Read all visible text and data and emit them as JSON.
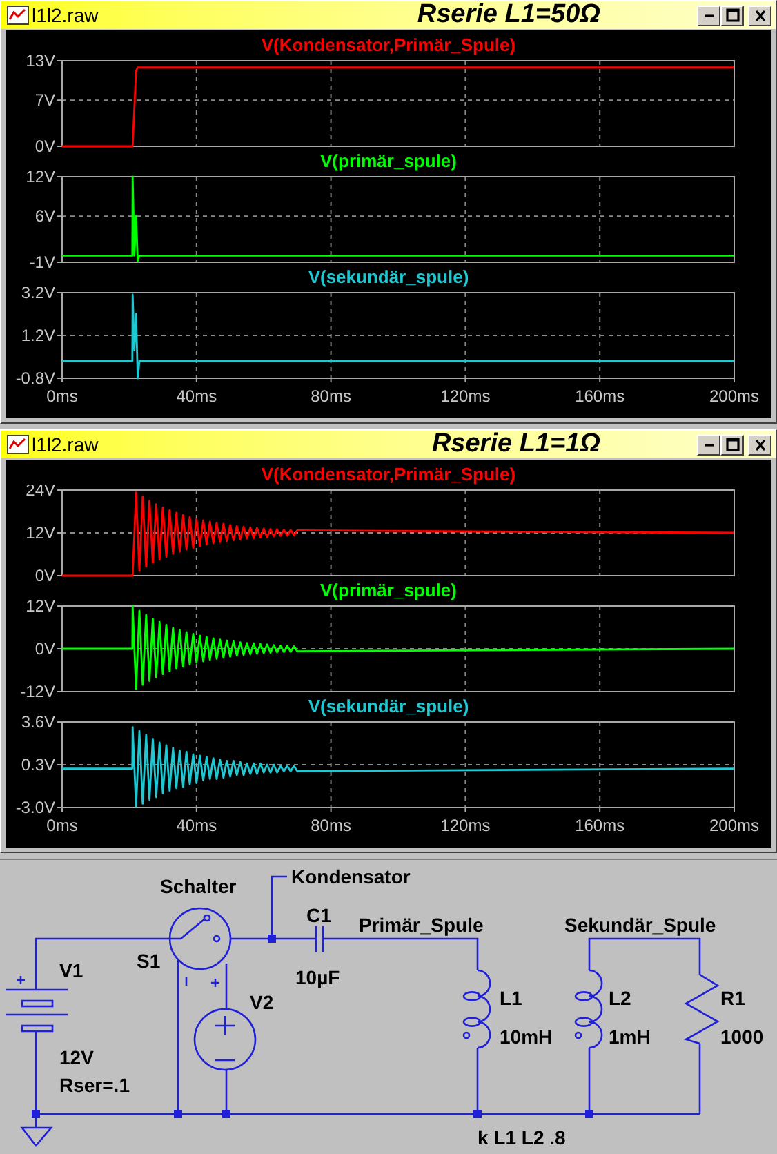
{
  "windows": [
    {
      "file": "l1l2.raw",
      "title": "Rserie L1=50Ω",
      "panes": [
        {
          "chart_data": {
            "type": "line",
            "grid": true,
            "x": [
              0,
              20.9,
              21,
              21.5,
              22,
              22.5,
              23,
              200
            ],
            "series": [
              {
                "name": "V(Kondensator,Primär_Spule)",
                "color": "#ff0000",
                "values": [
                  0,
                  0,
                  0,
                  6,
                  11.5,
                  12,
                  12,
                  12
                ]
              }
            ],
            "xlim": [
              0,
              200
            ],
            "ylim": [
              0,
              13
            ],
            "yticks": [
              {
                "value": 0,
                "label": "0V"
              },
              {
                "value": 7,
                "label": "7V"
              },
              {
                "value": 13,
                "label": "13V"
              }
            ]
          }
        },
        {
          "chart_data": {
            "type": "line",
            "grid": true,
            "x": [
              0,
              20.9,
              21,
              21.5,
              22,
              22.5,
              23,
              200
            ],
            "series": [
              {
                "name": "V(primär_spule)",
                "color": "#00ff00",
                "values": [
                  0,
                  0,
                  12,
                  0,
                  6,
                  -0.8,
                  0,
                  0
                ]
              }
            ],
            "xlim": [
              0,
              200
            ],
            "ylim": [
              -1,
              12
            ],
            "yticks": [
              {
                "value": -1,
                "label": "-1V"
              },
              {
                "value": 6,
                "label": "6V"
              },
              {
                "value": 12,
                "label": "12V"
              }
            ]
          }
        },
        {
          "chart_data": {
            "type": "line",
            "grid": true,
            "x": [
              0,
              20.9,
              21,
              21.5,
              22,
              22.5,
              23,
              200
            ],
            "series": [
              {
                "name": "V(sekundär_spule)",
                "color": "#1ec8d2",
                "values": [
                  0,
                  0,
                  3.1,
                  0.5,
                  2.2,
                  -0.8,
                  0,
                  0
                ]
              }
            ],
            "xlim": [
              0,
              200
            ],
            "ylim": [
              -0.8,
              3.2
            ],
            "yticks": [
              {
                "value": -0.8,
                "label": "-0.8V"
              },
              {
                "value": 1.2,
                "label": "1.2V"
              },
              {
                "value": 3.2,
                "label": "3.2V"
              }
            ],
            "xticks": [
              {
                "value": 0,
                "label": "0ms"
              },
              {
                "value": 40,
                "label": "40ms"
              },
              {
                "value": 80,
                "label": "80ms"
              },
              {
                "value": 120,
                "label": "120ms"
              },
              {
                "value": 160,
                "label": "160ms"
              },
              {
                "value": 200,
                "label": "200ms"
              }
            ]
          }
        }
      ]
    },
    {
      "file": "l1l2.raw",
      "title": "Rserie L1=1Ω",
      "panes": [
        {
          "chart_data": {
            "type": "line",
            "grid": true,
            "x": [
              0,
              20.9,
              21,
              22,
              23,
              24,
              25,
              26,
              27,
              28,
              29,
              30,
              31,
              32,
              33,
              34,
              35,
              36,
              37,
              38,
              39,
              40,
              41,
              42,
              43,
              44,
              45,
              46,
              47,
              48,
              49,
              50,
              51,
              52,
              53,
              54,
              55,
              56,
              57,
              58,
              59,
              60,
              61,
              62,
              63,
              64,
              65,
              66,
              67,
              68,
              69,
              70,
              200
            ],
            "series": [
              {
                "name": "V(Kondensator,Primär_Spule)",
                "color": "#ff0000",
                "values": [
                  0,
                  0,
                  0,
                  23.3,
                  1.3,
                  22.1,
                  2.5,
                  21,
                  3.6,
                  20,
                  4.5,
                  19.1,
                  5.3,
                  18.3,
                  6.1,
                  17.6,
                  6.7,
                  17,
                  7.3,
                  16.4,
                  7.8,
                  15.9,
                  8.3,
                  15.5,
                  8.7,
                  15.1,
                  9.1,
                  14.8,
                  9.4,
                  14.5,
                  9.7,
                  14.2,
                  9.9,
                  13.9,
                  10.2,
                  13.7,
                  10.4,
                  13.5,
                  10.5,
                  13.4,
                  10.7,
                  13.2,
                  10.8,
                  13.1,
                  11,
                  13,
                  11.1,
                  12.9,
                  11.2,
                  12.8,
                  11.3,
                  12.7,
                  12
                ]
              }
            ],
            "xlim": [
              0,
              200
            ],
            "ylim": [
              0,
              24
            ],
            "yticks": [
              {
                "value": 0,
                "label": "0V"
              },
              {
                "value": 12,
                "label": "12V"
              },
              {
                "value": 24,
                "label": "24V"
              }
            ]
          }
        },
        {
          "chart_data": {
            "type": "line",
            "grid": true,
            "x": [
              0,
              20.9,
              21,
              22,
              23,
              24,
              25,
              26,
              27,
              28,
              29,
              30,
              31,
              32,
              33,
              34,
              35,
              36,
              37,
              38,
              39,
              40,
              41,
              42,
              43,
              44,
              45,
              46,
              47,
              48,
              49,
              50,
              51,
              52,
              53,
              54,
              55,
              56,
              57,
              58,
              59,
              60,
              61,
              62,
              63,
              64,
              65,
              66,
              67,
              68,
              69,
              70,
              200
            ],
            "series": [
              {
                "name": "V(primär_spule)",
                "color": "#00ff00",
                "values": [
                  0,
                  0,
                  12,
                  -11.3,
                  10.7,
                  -10.1,
                  9.5,
                  -9,
                  8.4,
                  -8,
                  7.5,
                  -7.1,
                  6.7,
                  -6.3,
                  5.9,
                  -5.6,
                  5.3,
                  -5,
                  4.7,
                  -4.4,
                  4.2,
                  -3.9,
                  3.7,
                  -3.5,
                  3.3,
                  -3.1,
                  2.9,
                  -2.8,
                  2.6,
                  -2.5,
                  2.3,
                  -2.2,
                  2.1,
                  -1.9,
                  1.8,
                  -1.7,
                  1.6,
                  -1.5,
                  1.5,
                  -1.4,
                  1.3,
                  -1.2,
                  1.2,
                  -1.1,
                  1,
                  -1,
                  0.9,
                  -0.9,
                  0.8,
                  -0.8,
                  0.7,
                  -0.7,
                  0
                ]
              }
            ],
            "xlim": [
              0,
              200
            ],
            "ylim": [
              -12,
              12
            ],
            "yticks": [
              {
                "value": -12,
                "label": "-12V"
              },
              {
                "value": 0,
                "label": "0V"
              },
              {
                "value": 12,
                "label": "12V"
              }
            ]
          }
        },
        {
          "chart_data": {
            "type": "line",
            "grid": true,
            "x": [
              0,
              20.9,
              21,
              22,
              23,
              24,
              25,
              26,
              27,
              28,
              29,
              30,
              31,
              32,
              33,
              34,
              35,
              36,
              37,
              38,
              39,
              40,
              41,
              42,
              43,
              44,
              45,
              46,
              47,
              48,
              49,
              50,
              51,
              52,
              53,
              54,
              55,
              56,
              57,
              58,
              59,
              60,
              61,
              62,
              63,
              64,
              65,
              66,
              67,
              68,
              69,
              70,
              200
            ],
            "series": [
              {
                "name": "V(sekundär_spule)",
                "color": "#1ec8d2",
                "values": [
                  0,
                  0,
                  3.2,
                  -2.9,
                  2.9,
                  -2.7,
                  2.6,
                  -2.4,
                  2.3,
                  -2.2,
                  2,
                  -1.9,
                  1.8,
                  -1.7,
                  1.6,
                  -1.5,
                  1.4,
                  -1.4,
                  1.3,
                  -1.2,
                  1.1,
                  -1.1,
                  1,
                  -0.9,
                  0.9,
                  -0.8,
                  0.8,
                  -0.8,
                  0.7,
                  -0.7,
                  0.6,
                  -0.6,
                  0.6,
                  -0.5,
                  0.5,
                  -0.5,
                  0.4,
                  -0.4,
                  0.4,
                  -0.4,
                  0.4,
                  -0.3,
                  0.3,
                  -0.3,
                  0.3,
                  -0.3,
                  0.2,
                  -0.2,
                  0.2,
                  -0.2,
                  0.2,
                  -0.2,
                  0
                ]
              }
            ],
            "xlim": [
              0,
              200
            ],
            "ylim": [
              -3,
              3.6
            ],
            "yticks": [
              {
                "value": -3,
                "label": "-3.0V"
              },
              {
                "value": 0.3,
                "label": "0.3V"
              },
              {
                "value": 3.6,
                "label": "3.6V"
              }
            ],
            "xticks": [
              {
                "value": 0,
                "label": "0ms"
              },
              {
                "value": 40,
                "label": "40ms"
              },
              {
                "value": 80,
                "label": "80ms"
              },
              {
                "value": 120,
                "label": "120ms"
              },
              {
                "value": 160,
                "label": "160ms"
              },
              {
                "value": 200,
                "label": "200ms"
              }
            ]
          }
        }
      ]
    }
  ],
  "schematic": {
    "components": [
      {
        "kind": "battery",
        "name": "V1",
        "value": "12V",
        "param": "Rser=.1"
      },
      {
        "kind": "switch",
        "name": "S1",
        "model": "Schalter"
      },
      {
        "kind": "vsource",
        "name": "V2"
      },
      {
        "kind": "capacitor",
        "name": "C1",
        "value": "10µF"
      },
      {
        "kind": "inductor",
        "name": "L1",
        "value": "10mH"
      },
      {
        "kind": "inductor",
        "name": "L2",
        "value": "1mH"
      },
      {
        "kind": "resistor",
        "name": "R1",
        "value": "1000"
      }
    ],
    "net_labels": [
      "Kondensator",
      "Primär_Spule",
      "Sekundär_Spule"
    ],
    "directive": "k L1 L2 .8"
  }
}
